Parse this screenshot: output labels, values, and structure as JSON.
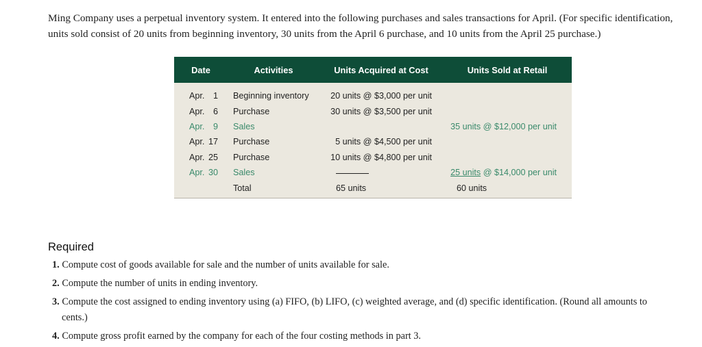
{
  "intro": "Ming Company uses a perpetual inventory system. It entered into the following purchases and sales transactions for April. (For specific identification, units sold consist of 20 units from beginning inventory, 30 units from the April 6 purchase, and 10 units from the April 25 purchase.)",
  "table": {
    "headers": {
      "date": "Date",
      "activities": "Activities",
      "acquired": "Units Acquired at Cost",
      "sold": "Units Sold at Retail"
    },
    "rows": [
      {
        "mon": "Apr.",
        "day": "1",
        "activity": "Beginning inventory",
        "acquired": "20 units @ $3,000 per unit",
        "sold": ""
      },
      {
        "mon": "Apr.",
        "day": "6",
        "activity": "Purchase",
        "acquired": "30 units @ $3,500 per unit",
        "sold": ""
      },
      {
        "mon": "Apr.",
        "day": "9",
        "activity": "Sales",
        "acquired": "",
        "sold": "35 units @ $12,000 per unit"
      },
      {
        "mon": "Apr.",
        "day": "17",
        "activity": "Purchase",
        "acquired": "5 units @ $4,500 per unit",
        "sold": ""
      },
      {
        "mon": "Apr.",
        "day": "25",
        "activity": "Purchase",
        "acquired": "10 units @ $4,800 per unit",
        "sold": ""
      },
      {
        "mon": "Apr.",
        "day": "30",
        "activity": "Sales",
        "acquired": "",
        "sold_units": "25 units",
        "sold_rest": "@ $14,000 per unit"
      }
    ],
    "total": {
      "label": "Total",
      "acquired": "65 units",
      "sold": "60 units"
    }
  },
  "required": {
    "title": "Required",
    "items": [
      {
        "num": "1.",
        "text": "Compute cost of goods available for sale and the number of units available for sale."
      },
      {
        "num": "2.",
        "text": "Compute the number of units in ending inventory."
      },
      {
        "num": "3.",
        "text": "Compute the cost assigned to ending inventory using (a) FIFO, (b) LIFO, (c) weighted average, and (d) specific identification. (Round all amounts to",
        "text2": "cents.)"
      },
      {
        "num": "4.",
        "text": "Compute gross profit earned by the company for each of the four costing methods in part 3."
      }
    ]
  }
}
